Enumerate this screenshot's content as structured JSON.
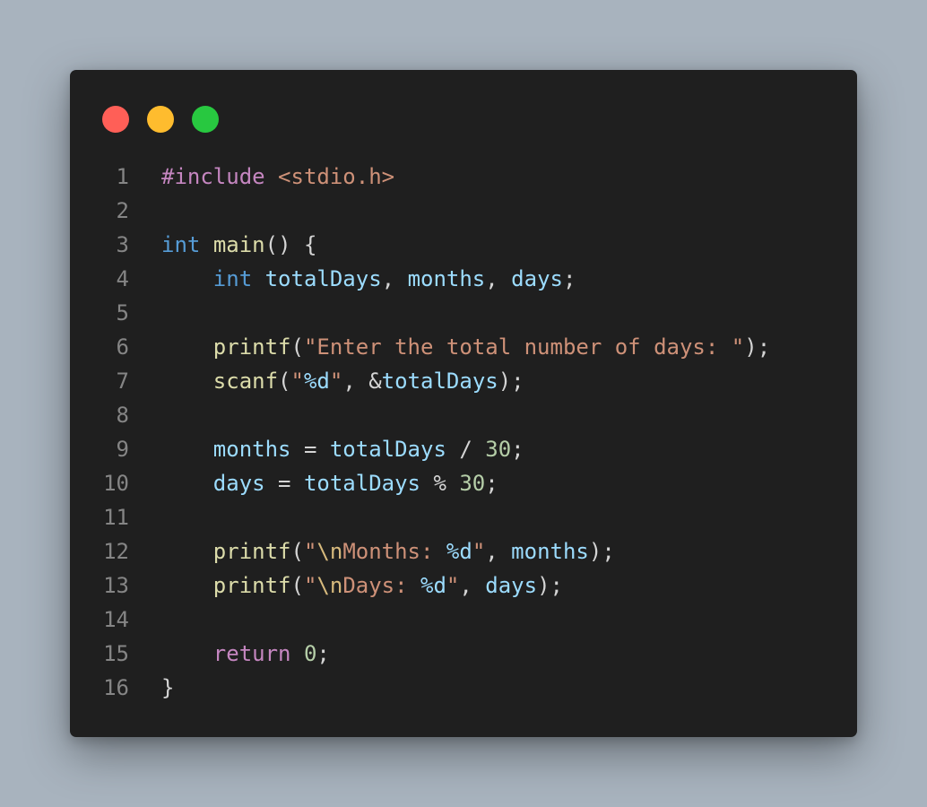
{
  "window": {
    "controls": [
      "close",
      "minimize",
      "maximize"
    ]
  },
  "code": {
    "language": "c",
    "lines": [
      {
        "num": "1",
        "text": "#include <stdio.h>"
      },
      {
        "num": "2",
        "text": ""
      },
      {
        "num": "3",
        "text": "int main() {"
      },
      {
        "num": "4",
        "text": "    int totalDays, months, days;"
      },
      {
        "num": "5",
        "text": ""
      },
      {
        "num": "6",
        "text": "    printf(\"Enter the total number of days: \");"
      },
      {
        "num": "7",
        "text": "    scanf(\"%d\", &totalDays);"
      },
      {
        "num": "8",
        "text": ""
      },
      {
        "num": "9",
        "text": "    months = totalDays / 30;"
      },
      {
        "num": "10",
        "text": "    days = totalDays % 30;"
      },
      {
        "num": "11",
        "text": ""
      },
      {
        "num": "12",
        "text": "    printf(\"\\nMonths: %d\", months);"
      },
      {
        "num": "13",
        "text": "    printf(\"\\nDays: %d\", days);"
      },
      {
        "num": "14",
        "text": ""
      },
      {
        "num": "15",
        "text": "    return 0;"
      },
      {
        "num": "16",
        "text": "}"
      }
    ]
  },
  "colors": {
    "background": "#a8b3be",
    "window": "#1f1f1f",
    "close": "#ff5f57",
    "minimize": "#febc2e",
    "maximize": "#28c840"
  }
}
